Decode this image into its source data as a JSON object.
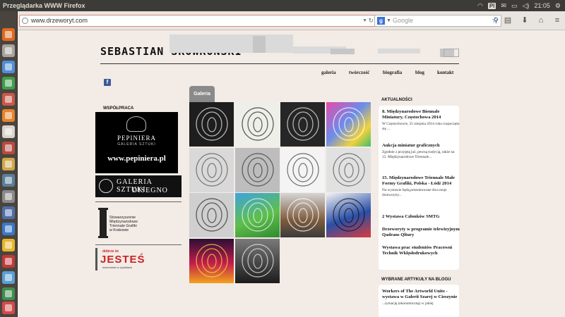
{
  "window": {
    "title": "Przeglądarka WWW Firefox",
    "clock": "21:05"
  },
  "icons": {
    "wifi": "wifi-icon",
    "keyboard": "keyboard-indicator",
    "mail": "mail-icon",
    "battery": "battery-icon",
    "volume": "volume-icon",
    "power": "gear-icon"
  },
  "keyboard_label": "Pl",
  "browser": {
    "url": "www.drzeworyt.com",
    "search_engine": "g",
    "search_placeholder": "Google"
  },
  "site": {
    "brand": "SEBASTIAN SKOWROŃSKI",
    "nav": [
      "galeria",
      "twórczość",
      "biografia",
      "blog",
      "kontakt"
    ],
    "facebook": "f",
    "sidebar": {
      "heading": "WSPÓŁPRACA",
      "pepiniera_name": "PEPINIERA",
      "pepiniera_sub": "GALERIA SZTUKI",
      "pepiniera_url": "www.pepiniera.pl",
      "disegno_line1": "GALERIA SZTUKI",
      "disegno_line2": "DISEGNO",
      "smtg_text": [
        "Stowarzyszenie",
        "Międzynarodowe",
        "Triennale Grafiki",
        "w Krakowie"
      ],
      "jestes_top": "dobrze że",
      "jestes_main": "JESTEŚ",
      "jestes_bottom": "wolontariat w szpitalach"
    },
    "gallery": {
      "tab": "Galeria",
      "thumbs": [
        {
          "bg": "#1e1e1e",
          "fg": "#f2f2f2"
        },
        {
          "bg": "#efefe9",
          "fg": "#222222"
        },
        {
          "bg": "#262626",
          "fg": "#eeeeee"
        },
        {
          "bg": "linear-gradient(135deg,#e84aa8,#6b8dea 45%,#f2d23a 75%,#3cbf6a)",
          "fg": "#ffffff"
        },
        {
          "bg": "#d9d9d9",
          "fg": "#555555"
        },
        {
          "bg": "#bdbdbd",
          "fg": "#3a3a3a"
        },
        {
          "bg": "#f4f4f4",
          "fg": "#444444"
        },
        {
          "bg": "#e1e1e1",
          "fg": "#555555"
        },
        {
          "bg": "#cfcfcf",
          "fg": "#2a2a2a"
        },
        {
          "bg": "linear-gradient(160deg,#3fa3df,#5fbf4a 55%,#2f8a2f)",
          "fg": "#e8f4ff"
        },
        {
          "bg": "linear-gradient(180deg,#d5d5d5,#7f5d3f 60%,#3a3a3a)",
          "fg": "#ffffff"
        },
        {
          "bg": "linear-gradient(160deg,#f3f3f3,#2a4fa8 55%,#d93b3b)",
          "fg": "#111111"
        },
        {
          "bg": "linear-gradient(180deg,#2b0f35,#c31d4b 55%,#f2a21d)",
          "fg": "#f9e04a"
        },
        {
          "bg": "linear-gradient(180deg,#7a7a7a,#1c1c1c)",
          "fg": "#eeeeee"
        }
      ]
    },
    "news": {
      "heading": "AKTUALNOŚCI",
      "items": [
        {
          "title": "8. Międzynarodowe Biennale Miniatury, Częstochowa 2014",
          "excerpt": "W Częstochowie, 25 sierpnia 2014 roku rozpoczęło się ..."
        },
        {
          "title": "Aukcja miniatur graficznych",
          "excerpt": "Zgodnie z przyjętą już, pewną tradycją, także na 15. Międzynarodowe Triennale..."
        },
        {
          "title": "15. Międzynarodowe Triennale Małe Formy Grafiki, Polska - Łódź 2014",
          "excerpt": "Na wystawie będą prezentowane dwa moje drzeworyty..."
        },
        {
          "title": "2 Wystawa Członków SMTG",
          "excerpt": ""
        },
        {
          "title": "Drzeworyty w programie telewizyjnym Qadrans Qltury",
          "excerpt": ""
        },
        {
          "title": "Wystawa prac studentów Pracowni Technik Wklęsłodrukowych",
          "excerpt": ""
        }
      ]
    },
    "blog": {
      "heading": "WYBRANE ARTYKUŁY NA BLOGU",
      "item_title": "Workers of The Artworld Unite - wystawa w Galerii Szarej w Cieszynie",
      "item_excerpt": "...sytuację (ekonomiczną) w jakiej"
    }
  }
}
